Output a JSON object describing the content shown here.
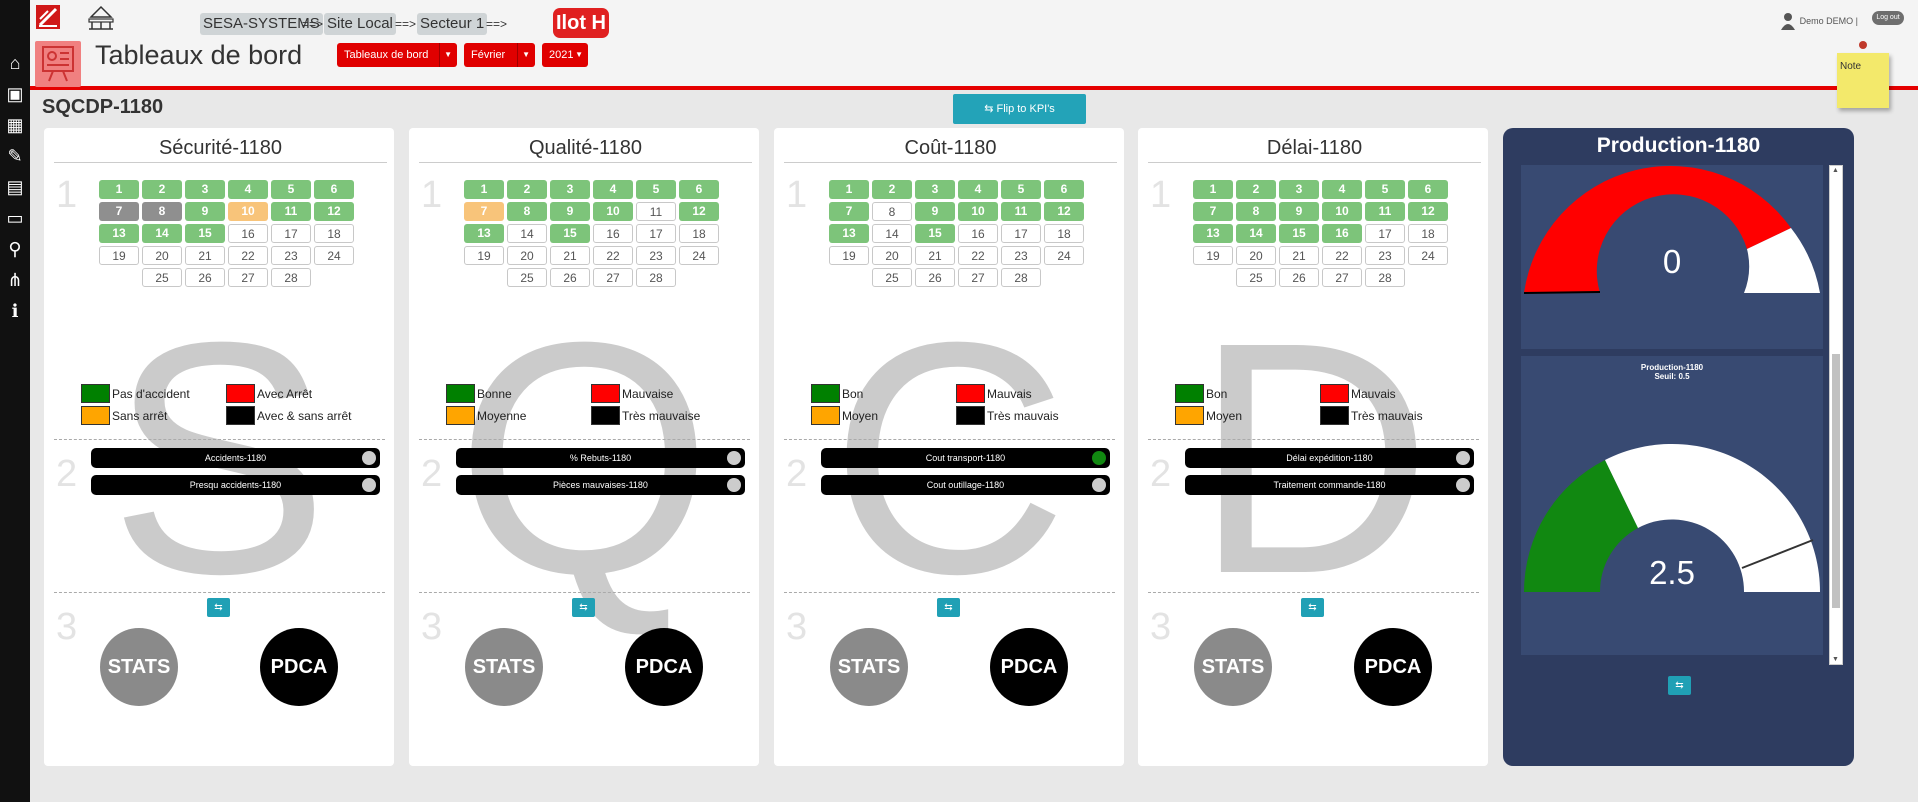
{
  "header": {
    "breadcrumbs": [
      "SESA-SYSTEMS",
      "Site Local",
      "Secteur 1"
    ],
    "separator": "==>",
    "ilot": "Ilot H",
    "user": "Demo DEMO |",
    "logout": "Log out"
  },
  "page": {
    "title": "Tableaux de bord",
    "dropdowns": [
      "Tableaux de bord",
      "Février",
      "2021"
    ],
    "note": "Note",
    "subtitle": "SQCDP-1180",
    "flip_label": "Flip to KPI's"
  },
  "colors": {
    "green": "#7dc47a",
    "gray": "#8f8f8f",
    "orange": "#f8c47a",
    "red": "#ff0000",
    "accent": "#e00000",
    "teal": "#23a3b8"
  },
  "icons": [
    "home-icon",
    "presentation-icon",
    "building-icon",
    "clipboard-icon",
    "calendar-icon",
    "monitor-icon",
    "walker-icon",
    "hierarchy-icon",
    "info-icon"
  ],
  "section_numbers": {
    "one": "1",
    "two": "2",
    "three": "3"
  },
  "buttons": {
    "stats": "STATS",
    "pdca": "PDCA"
  },
  "cards": [
    {
      "title": "Sécurité-1180",
      "letter": "S",
      "days": [
        "g",
        "g",
        "g",
        "g",
        "g",
        "g",
        "d",
        "d",
        "g",
        "o",
        "g",
        "g",
        "g",
        "g",
        "g",
        "w",
        "w",
        "w",
        "w",
        "w",
        "w",
        "w",
        "w",
        "w",
        "w",
        "w",
        "w",
        "w"
      ],
      "legend": [
        "Pas d'accident",
        "Avec Arrêt",
        "Sans arrêt",
        "Avec & sans arrêt"
      ],
      "kpis": [
        {
          "label": "Accidents-1180",
          "status": "gray"
        },
        {
          "label": "Presqu accidents-1180",
          "status": "gray"
        }
      ]
    },
    {
      "title": "Qualité-1180",
      "letter": "Q",
      "days": [
        "g",
        "g",
        "g",
        "g",
        "g",
        "g",
        "o",
        "g",
        "g",
        "g",
        "w",
        "g",
        "g",
        "w",
        "g",
        "w",
        "w",
        "w",
        "w",
        "w",
        "w",
        "w",
        "w",
        "w",
        "w",
        "w",
        "w",
        "w"
      ],
      "legend": [
        "Bonne",
        "Mauvaise",
        "Moyenne",
        "Très mauvaise"
      ],
      "kpis": [
        {
          "label": "% Rebuts-1180",
          "status": "gray"
        },
        {
          "label": "Pièces mauvaises-1180",
          "status": "gray"
        }
      ]
    },
    {
      "title": "Coût-1180",
      "letter": "C",
      "days": [
        "g",
        "g",
        "g",
        "g",
        "g",
        "g",
        "g",
        "w",
        "g",
        "g",
        "g",
        "g",
        "g",
        "w",
        "g",
        "w",
        "w",
        "w",
        "w",
        "w",
        "w",
        "w",
        "w",
        "w",
        "w",
        "w",
        "w",
        "w"
      ],
      "legend": [
        "Bon",
        "Mauvais",
        "Moyen",
        "Très mauvais"
      ],
      "kpis": [
        {
          "label": "Cout transport-1180",
          "status": "green"
        },
        {
          "label": "Cout outillage-1180",
          "status": "gray"
        }
      ]
    },
    {
      "title": "Délai-1180",
      "letter": "D",
      "days": [
        "g",
        "g",
        "g",
        "g",
        "g",
        "g",
        "g",
        "g",
        "g",
        "g",
        "g",
        "g",
        "g",
        "g",
        "g",
        "g",
        "w",
        "w",
        "w",
        "w",
        "w",
        "w",
        "w",
        "w",
        "w",
        "w",
        "w",
        "w"
      ],
      "legend": [
        "Bon",
        "Mauvais",
        "Moyen",
        "Très mauvais"
      ],
      "kpis": [
        {
          "label": "Délai expédition-1180",
          "status": "gray"
        },
        {
          "label": "Traitement commande-1180",
          "status": "gray"
        }
      ]
    }
  ],
  "production": {
    "title": "Production-1180",
    "gauge1": {
      "value": "0"
    },
    "gauge2": {
      "label": "Production-1180",
      "seuil": "Seuil: 0.5",
      "value": "2.5"
    }
  }
}
